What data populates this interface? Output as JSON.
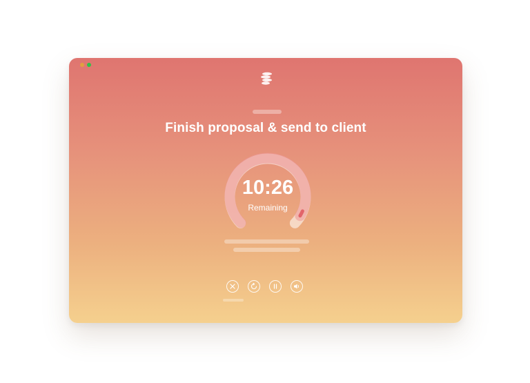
{
  "task": {
    "title": "Finish proposal & send to client"
  },
  "timer": {
    "time": "10:26",
    "label": "Remaining",
    "progress": 0.95
  },
  "icons": {
    "logo": "stacked-lines-logo-icon",
    "controls": [
      "close-icon",
      "reset-icon",
      "pause-icon",
      "sound-icon"
    ]
  },
  "colors": {
    "gradient_top": "#df7570",
    "gradient_bottom": "#f5d08e",
    "accent": "#e2646a",
    "window_close": "#e0a040",
    "window_zoom": "#2fc249"
  }
}
